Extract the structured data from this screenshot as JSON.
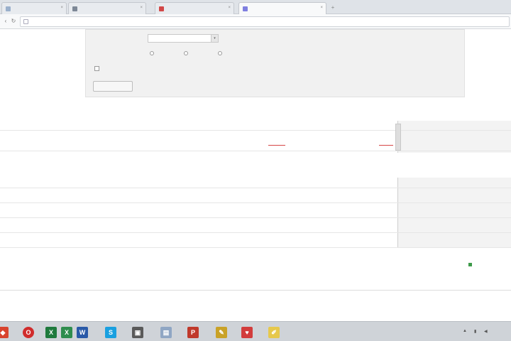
{
  "browser": {
    "tabs": [
      {
        "label": "",
        "color": "#9ab0cc"
      },
      {
        "label": "",
        "color": "#7d8896"
      },
      {
        "label": "",
        "color": "#d24848"
      },
      {
        "label": "",
        "color": "#7f7fe0"
      }
    ],
    "new_tab_label": "+",
    "url": ""
  },
  "filter": {
    "period_label": "",
    "period_value": "",
    "group_label": "",
    "radio_options": [
      "",
      "",
      ""
    ],
    "checkbox_label": "",
    "button_label": ""
  },
  "summary_table": {
    "columns": [
      "",
      "",
      "",
      "",
      "",
      "",
      "",
      "",
      ""
    ],
    "row": [
      "",
      "",
      "",
      "",
      "",
      "",
      "",
      "",
      ""
    ]
  },
  "detail_section": {
    "title": "",
    "right_link": "",
    "columns": [
      "",
      "",
      "",
      "",
      "",
      "",
      "",
      ""
    ],
    "rows": [
      [
        "",
        "",
        "",
        "",
        "",
        "",
        "",
        ""
      ],
      [
        "",
        "",
        "",
        "",
        "",
        "",
        "",
        ""
      ],
      [
        "",
        "",
        "",
        "",
        "",
        "",
        "",
        ""
      ],
      [
        "",
        "",
        "",
        "",
        "",
        "",
        "",
        ""
      ]
    ]
  },
  "footer": {
    "timestamp": "",
    "center_link": "",
    "right_link_1": "",
    "right_link_2": "",
    "lines": [
      "",
      "",
      "",
      ""
    ],
    "bottom_right": [
      "",
      ""
    ]
  },
  "taskbar": {
    "icons": [
      {
        "name": "windows-icon",
        "color": "#d8432e"
      },
      {
        "name": "opera-icon",
        "color": "#d02c2c"
      },
      {
        "name": "excel-icon",
        "color": "#1f7a3d"
      },
      {
        "name": "excel-icon-2",
        "color": "#2f8d4e"
      },
      {
        "name": "word-icon",
        "color": "#2a5aa8"
      },
      {
        "name": "skype-icon",
        "color": "#1aa0e0"
      },
      {
        "name": "app-icon",
        "color": "#5a5a5a"
      },
      {
        "name": "file-icon",
        "color": "#8fa6c4"
      },
      {
        "name": "pdf-icon",
        "color": "#c0392b"
      },
      {
        "name": "paint-icon",
        "color": "#c9a227"
      },
      {
        "name": "gift-icon",
        "color": "#d23c3c"
      },
      {
        "name": "notes-icon",
        "color": "#e6c84c"
      }
    ],
    "clock": ""
  }
}
